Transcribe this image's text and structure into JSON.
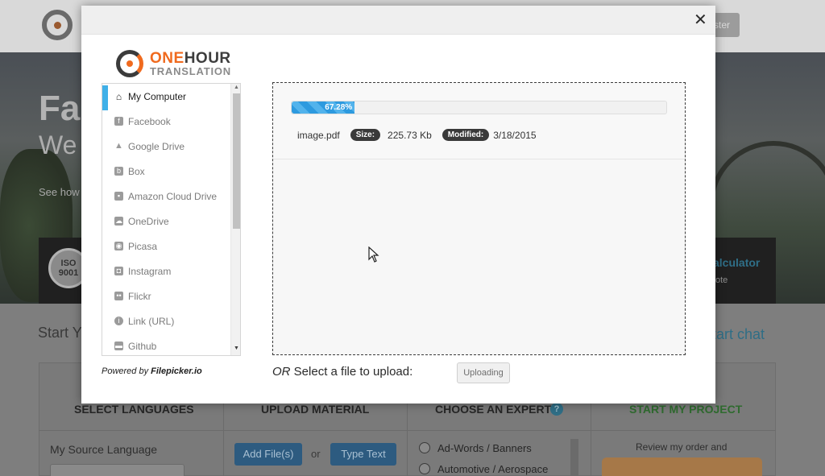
{
  "background": {
    "register_label": "ster",
    "hero_title": "Fa",
    "hero_subtitle": "We",
    "hero_small": "See how",
    "iso_label": "ISO 9001",
    "calc_label": "alculator",
    "quote_label": "ote",
    "start_label": "Start Y",
    "chat_label": "tart chat",
    "columns": [
      "SELECT LANGUAGES",
      "UPLOAD MATERIAL",
      "CHOOSE AN EXPERT",
      "START MY PROJECT"
    ],
    "source_language_label": "My Source Language",
    "add_files_label": "Add File(s)",
    "or_label": "or",
    "type_text_label": "Type Text",
    "expert_options": [
      "Ad-Words / Banners",
      "Automotive / Aerospace"
    ],
    "review_label": "Review my order and",
    "help_icon": "?"
  },
  "modal": {
    "close_label": "✕",
    "brand": {
      "name_orange": "ONE",
      "name_dark": "HOUR",
      "sub": "TRANSLATION"
    },
    "sources": [
      {
        "label": "My Computer",
        "icon": "home-icon"
      },
      {
        "label": "Facebook",
        "icon": "facebook-icon"
      },
      {
        "label": "Google Drive",
        "icon": "google-drive-icon"
      },
      {
        "label": "Box",
        "icon": "box-icon"
      },
      {
        "label": "Amazon Cloud Drive",
        "icon": "amazon-cloud-drive-icon"
      },
      {
        "label": "OneDrive",
        "icon": "onedrive-icon"
      },
      {
        "label": "Picasa",
        "icon": "picasa-icon"
      },
      {
        "label": "Instagram",
        "icon": "instagram-icon"
      },
      {
        "label": "Flickr",
        "icon": "flickr-icon"
      },
      {
        "label": "Link (URL)",
        "icon": "link-icon"
      },
      {
        "label": "Github",
        "icon": "github-icon"
      }
    ],
    "powered_prefix": "Powered by ",
    "powered_brand": "Filepicker.io",
    "upload": {
      "progress_percent": 67.28,
      "progress_label": "67.28%",
      "file_name": "image.pdf",
      "size_label": "Size:",
      "size_value": "225.73 Kb",
      "modified_label": "Modified:",
      "modified_value": "3/18/2015"
    },
    "or_word": "OR",
    "select_text": " Select a file to upload:",
    "upload_button_label": "Uploading"
  },
  "colors": {
    "accent_blue": "#3fb0e8",
    "brand_orange": "#f06a1e",
    "progress_blue": "#2d9adf"
  }
}
